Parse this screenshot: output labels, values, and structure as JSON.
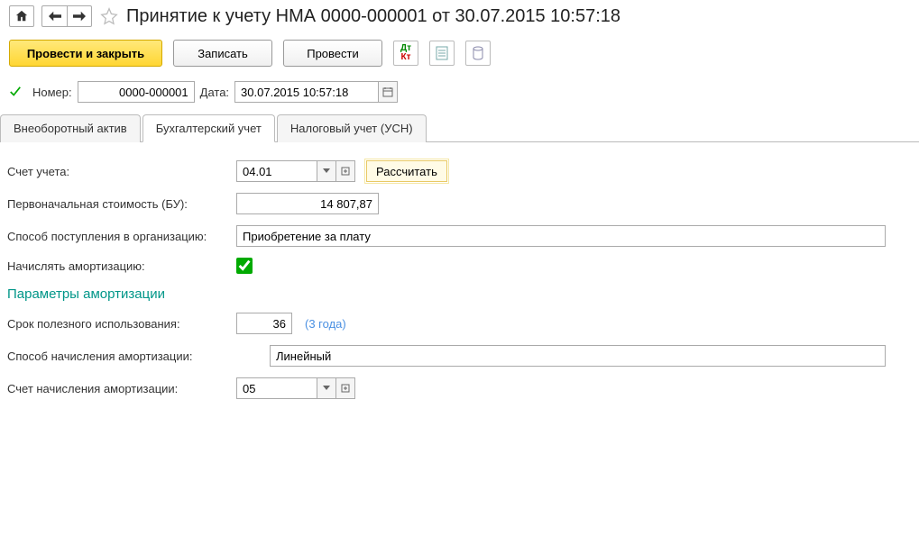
{
  "title": "Принятие к учету НМА 0000-000001 от 30.07.2015 10:57:18",
  "toolbar": {
    "post_and_close": "Провести и закрыть",
    "write": "Записать",
    "post": "Провести"
  },
  "fields": {
    "number_label": "Номер:",
    "number_value": "0000-000001",
    "date_label": "Дата:",
    "date_value": "30.07.2015 10:57:18"
  },
  "tabs": {
    "tab1": "Внеоборотный актив",
    "tab2": "Бухгалтерский учет",
    "tab3": "Налоговый учет (УСН)"
  },
  "form": {
    "account_label": "Счет учета:",
    "account_value": "04.01",
    "calc_btn": "Рассчитать",
    "initial_cost_label": "Первоначальная стоимость (БУ):",
    "initial_cost_value": "14 807,87",
    "receipt_method_label": "Способ поступления в организацию:",
    "receipt_method_value": "Приобретение за плату",
    "amort_label": "Начислять амортизацию:",
    "section_header": "Параметры амортизации",
    "useful_life_label": "Срок полезного использования:",
    "useful_life_value": "36",
    "useful_life_hint": "(3 года)",
    "amort_method_label": "Способ начисления амортизации:",
    "amort_method_value": "Линейный",
    "amort_account_label": "Счет начисления амортизации:",
    "amort_account_value": "05"
  }
}
